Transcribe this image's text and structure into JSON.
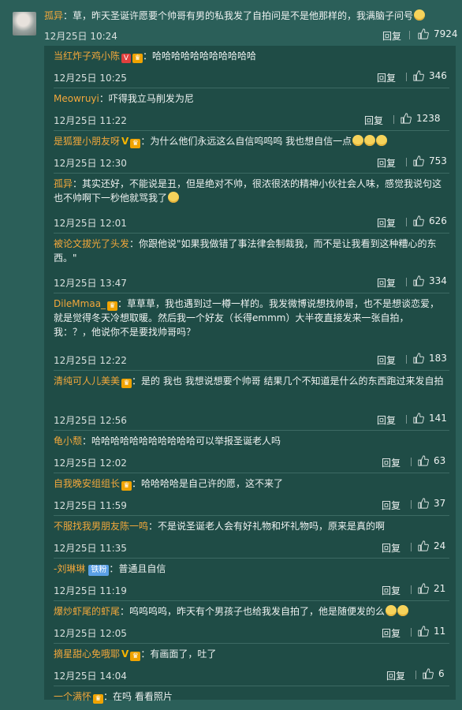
{
  "main_comment": {
    "user": "孤异",
    "text": "：草，昨天圣诞许愿要个帅哥有男的私我发了自拍问是不是他那样的，我满脑子问号",
    "time": "12月25日 10:24",
    "reply_label": "回复",
    "likes": "7924"
  },
  "replies": [
    {
      "user": "当红炸子鸡小陈",
      "badges": [
        "v-red",
        "gold"
      ],
      "text": "：哈哈哈哈哈哈哈哈哈哈哈",
      "time": "12月25日 10:25",
      "reply_label": "回复",
      "likes": "346"
    },
    {
      "user": "Meowruyi",
      "badges": [],
      "text": "：吓得我立马削发为尼",
      "time": "12月25日 11:22",
      "reply_label": "回复",
      "likes": "1238"
    },
    {
      "user": "是狐狸小朋友呀",
      "badges": [
        "v-yellow",
        "gold"
      ],
      "text": "：为什么他们永远这么自信呜呜呜 我也想自信一点",
      "time": "12月25日 12:30",
      "reply_label": "回复",
      "likes": "753"
    },
    {
      "user": "孤异",
      "badges": [],
      "text": "：其实还好，不能说是丑，但是绝对不帅，很浓很浓的精神小伙社会人味，感觉我说句这也不帅啊下一秒他就骂我了",
      "time": "12月25日 12:01",
      "reply_label": "回复",
      "likes": "626"
    },
    {
      "user": "被论文拔光了头发",
      "badges": [],
      "text": "：你跟他说\"如果我做错了事法律会制裁我，而不是让我看到这种糟心的东西。\"",
      "time": "12月25日 13:47",
      "reply_label": "回复",
      "likes": "334"
    },
    {
      "user": "DileMmaa_",
      "badges": [
        "gold"
      ],
      "text": "：草草草，我也遇到过一樽一样的。我发微博说想找帅哥，也不是想谈恋爱，就是觉得冬天冷想取暖。然后我一个好友（长得emmm）大半夜直接发来一张自拍，我：？，他说你不是要找帅哥吗？",
      "time": "12月25日 12:22",
      "reply_label": "回复",
      "likes": "183"
    },
    {
      "user": "清纯可人儿美美",
      "badges": [
        "gold"
      ],
      "text": "：是的 我也 我想说想要个帅哥 结果几个不知道是什么的东西跑过来发自拍",
      "time": "12月25日 12:56",
      "reply_label": "回复",
      "likes": "141"
    },
    {
      "user": "龟小颓",
      "badges": [],
      "text": "：哈哈哈哈哈哈哈哈哈哈哈可以举报圣诞老人吗",
      "time": "12月25日 12:02",
      "reply_label": "回复",
      "likes": "63"
    },
    {
      "user": "自我晚安组组长",
      "badges": [
        "gold"
      ],
      "text": "：哈哈哈哈是自己许的愿，这不来了",
      "time": "12月25日 11:59",
      "reply_label": "回复",
      "likes": "37"
    },
    {
      "user": "不服找我男朋友陈一鸣",
      "badges": [],
      "text": "：不是说圣诞老人会有好礼物和坏礼物吗，原来是真的啊",
      "time": "12月25日 11:35",
      "reply_label": "回复",
      "likes": "24"
    },
    {
      "user": "-刘琳琳",
      "badges": [
        "fan"
      ],
      "text": "：普通且自信",
      "time": "12月25日 11:19",
      "reply_label": "回复",
      "likes": "21"
    },
    {
      "user": "爆炒虾尾的虾尾",
      "badges": [],
      "text": "：呜呜呜呜，昨天有个男孩子也给我发自拍了，他是随便发的么",
      "time": "12月25日 12:05",
      "reply_label": "回复",
      "likes": "11"
    },
    {
      "user": "摘星甜心免哦耶",
      "badges": [
        "v-yellow",
        "gold"
      ],
      "text": "：有画面了，吐了",
      "time": "12月25日 14:04",
      "reply_label": "回复",
      "likes": "6"
    },
    {
      "user": "一个满怀",
      "badges": [
        "gold"
      ],
      "text": "：在吗 看看照片",
      "time": "",
      "reply_label": "",
      "likes": ""
    }
  ],
  "badges_text": {
    "fan": "铁粉"
  },
  "colors": {
    "background": "#2b5f59",
    "panel": "#1f4c46",
    "username": "#f2a73b",
    "text": "#eef2f1"
  },
  "icons": [
    "thumbs-up-icon",
    "smiley-emoji-icon"
  ]
}
